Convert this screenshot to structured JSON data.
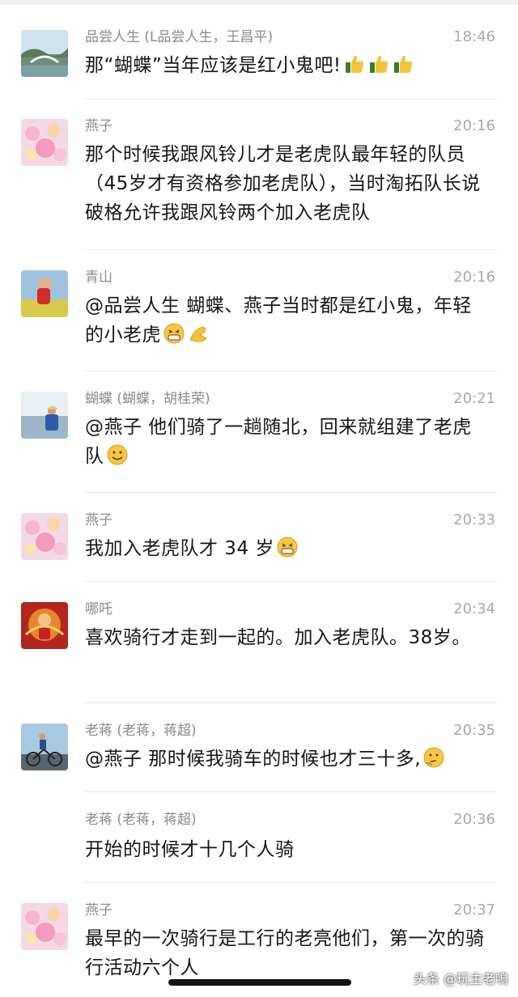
{
  "messages": [
    {
      "sender": "品尝人生 (L品尝人生，王昌平)",
      "time": "18:46",
      "text": "那“蝴蝶”当年应该是红小鬼吧!",
      "emojis": "thumbs-up ×3",
      "avatar": "lake-bridge-photo"
    },
    {
      "sender": "燕子",
      "time": "20:16",
      "text": "那个时候我跟风铃儿才是老虎队最年轻的队员（45岁才有资格参加老虎队），当时淘拓队长说破格允许我跟风铃两个加入老虎队",
      "avatar": "pink-flowers-photo"
    },
    {
      "sender": "青山",
      "time": "20:16",
      "text": "@品尝人生 蝴蝶、燕子当时都是红小鬼，年轻的小老虎",
      "emojis": "grin, ok-hand",
      "avatar": "person-in-field-photo"
    },
    {
      "sender": "蝴蝶 (蝴蝶，胡桂荣)",
      "time": "20:21",
      "text": "@燕子 他们骑了一趟随北，回来就组建了老虎队",
      "emojis": "smile",
      "avatar": "seaside-person-photo"
    },
    {
      "sender": "燕子",
      "time": "20:33",
      "text": "我加入老虎队才 34 岁",
      "emojis": "grin",
      "avatar": "pink-flowers-photo"
    },
    {
      "sender": "哪吒",
      "time": "20:34",
      "text": "喜欢骑行才走到一起的。加入老虎队。38岁。",
      "avatar": "nezha-cartoon"
    },
    {
      "sender": "老蒋 (老蒋，蒋超)",
      "time": "20:35",
      "text": "@燕子 那时候我骑车的时候也才三十多,",
      "emojis": "thinking",
      "avatar": "cyclist-photo"
    },
    {
      "sender": "老蒋 (老蒋，蒋超)",
      "time": "20:36",
      "text": "开始的时候才十几个人骑"
    },
    {
      "sender": "燕子",
      "time": "20:37",
      "text": "最早的一次骑行是工行的老亮他们，第一次的骑行活动六个人",
      "avatar": "pink-flowers-photo"
    }
  ],
  "watermark": "头条 @玩主老鳴",
  "colors": {
    "sender": "#8a8a8a",
    "time": "#a8a8a8",
    "text": "#161616",
    "divider": "#e6e6e6"
  }
}
